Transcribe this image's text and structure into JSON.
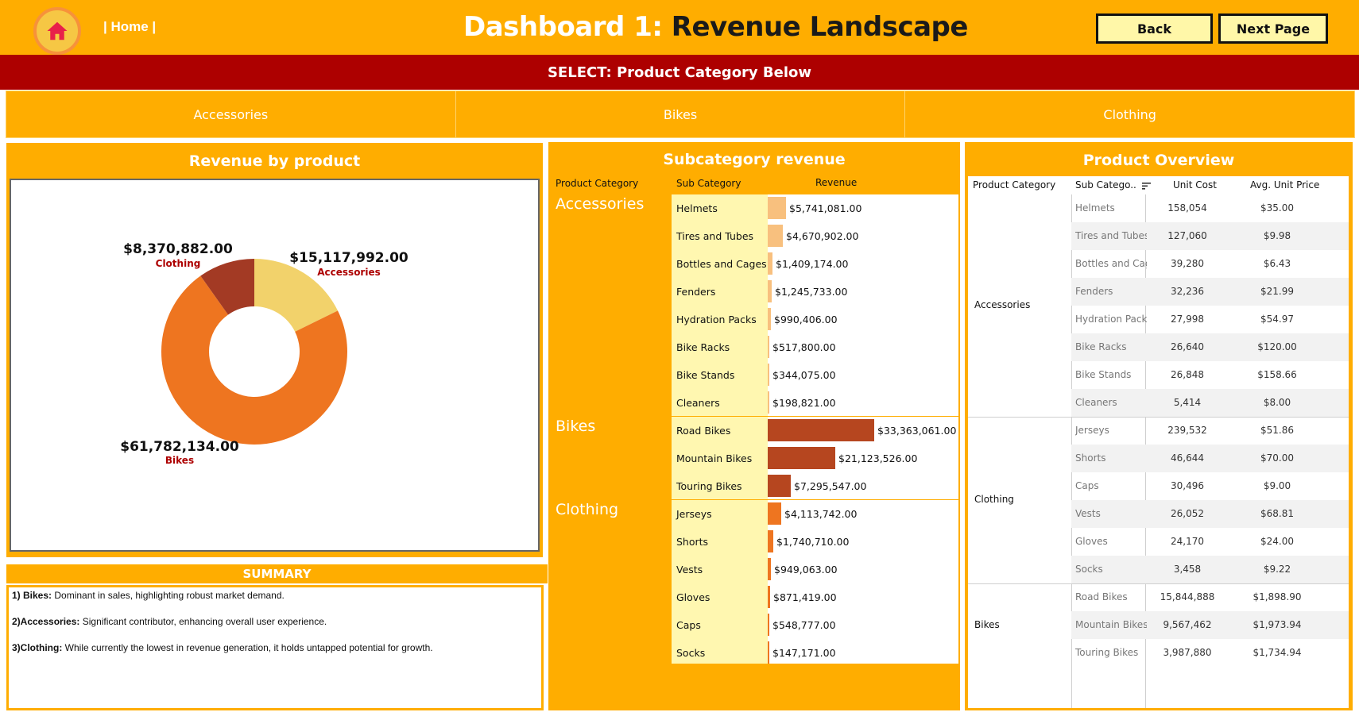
{
  "header": {
    "home_label": "| Home |",
    "title_prefix": "Dashboard 1:",
    "title_main": "Revenue Landscape",
    "back_label": "Back",
    "next_label": "Next Page",
    "accent_color": "#FFAD00",
    "banner_color": "#AD0000"
  },
  "select_banner": "SELECT: Product Category Below",
  "category_filter": [
    "Accessories",
    "Bikes",
    "Clothing"
  ],
  "revenue_by_product": {
    "title": "Revenue by product",
    "slices": [
      {
        "label": "Accessories",
        "value_text": "$15,117,992.00",
        "color": "#F2D26B"
      },
      {
        "label": "Bikes",
        "value_text": "$61,782,134.00",
        "color": "#EE7520"
      },
      {
        "label": "Clothing",
        "value_text": "$8,370,882.00",
        "color": "#A33A24"
      }
    ]
  },
  "summary": {
    "title": "SUMMARY",
    "items": [
      {
        "head": "1) Bikes:",
        "text": " Dominant in sales, highlighting robust market demand."
      },
      {
        "head": "2)Accessories:",
        "text": " Significant contributor, enhancing overall user experience."
      },
      {
        "head": "3)Clothing:",
        "text": " While currently the lowest in revenue generation, it holds untapped potential for growth."
      }
    ]
  },
  "subcategory_revenue": {
    "title": "Subcategory revenue",
    "col_category": "Product Category",
    "col_sub": "Sub Category",
    "col_revenue": "Revenue",
    "groups": [
      {
        "category": "Accessories",
        "rows": [
          {
            "sub": "Helmets",
            "revenue_text": "$5,741,081.00",
            "revenue": 5741081
          },
          {
            "sub": "Tires and Tubes",
            "revenue_text": "$4,670,902.00",
            "revenue": 4670902
          },
          {
            "sub": "Bottles and Cages",
            "revenue_text": "$1,409,174.00",
            "revenue": 1409174
          },
          {
            "sub": "Fenders",
            "revenue_text": "$1,245,733.00",
            "revenue": 1245733
          },
          {
            "sub": "Hydration Packs",
            "revenue_text": "$990,406.00",
            "revenue": 990406
          },
          {
            "sub": "Bike Racks",
            "revenue_text": "$517,800.00",
            "revenue": 517800
          },
          {
            "sub": "Bike Stands",
            "revenue_text": "$344,075.00",
            "revenue": 344075
          },
          {
            "sub": "Cleaners",
            "revenue_text": "$198,821.00",
            "revenue": 198821
          }
        ]
      },
      {
        "category": "Bikes",
        "rows": [
          {
            "sub": "Road Bikes",
            "revenue_text": "$33,363,061.00",
            "revenue": 33363061
          },
          {
            "sub": "Mountain Bikes",
            "revenue_text": "$21,123,526.00",
            "revenue": 21123526
          },
          {
            "sub": "Touring Bikes",
            "revenue_text": "$7,295,547.00",
            "revenue": 7295547
          }
        ]
      },
      {
        "category": "Clothing",
        "rows": [
          {
            "sub": "Jerseys",
            "revenue_text": "$4,113,742.00",
            "revenue": 4113742
          },
          {
            "sub": "Shorts",
            "revenue_text": "$1,740,710.00",
            "revenue": 1740710
          },
          {
            "sub": "Vests",
            "revenue_text": "$949,063.00",
            "revenue": 949063
          },
          {
            "sub": "Gloves",
            "revenue_text": "$871,419.00",
            "revenue": 871419
          },
          {
            "sub": "Caps",
            "revenue_text": "$548,777.00",
            "revenue": 548777
          },
          {
            "sub": "Socks",
            "revenue_text": "$147,171.00",
            "revenue": 147171
          }
        ]
      }
    ]
  },
  "product_overview": {
    "title": "Product Overview",
    "col_category": "Product Category",
    "col_sub": "Sub Catego..",
    "col_cost": "Unit Cost",
    "col_price": "Avg. Unit Price",
    "groups": [
      {
        "category": "Accessories",
        "rows": [
          {
            "sub": "Helmets",
            "cost": "158,054",
            "price": "$35.00"
          },
          {
            "sub": "Tires and Tubes",
            "cost": "127,060",
            "price": "$9.98"
          },
          {
            "sub": "Bottles and Cages",
            "cost": "39,280",
            "price": "$6.43"
          },
          {
            "sub": "Fenders",
            "cost": "32,236",
            "price": "$21.99"
          },
          {
            "sub": "Hydration Packs",
            "cost": "27,998",
            "price": "$54.97"
          },
          {
            "sub": "Bike Racks",
            "cost": "26,640",
            "price": "$120.00"
          },
          {
            "sub": "Bike Stands",
            "cost": "26,848",
            "price": "$158.66"
          },
          {
            "sub": "Cleaners",
            "cost": "5,414",
            "price": "$8.00"
          }
        ]
      },
      {
        "category": "Clothing",
        "rows": [
          {
            "sub": "Jerseys",
            "cost": "239,532",
            "price": "$51.86"
          },
          {
            "sub": "Shorts",
            "cost": "46,644",
            "price": "$70.00"
          },
          {
            "sub": "Caps",
            "cost": "30,496",
            "price": "$9.00"
          },
          {
            "sub": "Vests",
            "cost": "26,052",
            "price": "$68.81"
          },
          {
            "sub": "Gloves",
            "cost": "24,170",
            "price": "$24.00"
          },
          {
            "sub": "Socks",
            "cost": "3,458",
            "price": "$9.22"
          }
        ]
      },
      {
        "category": "Bikes",
        "rows": [
          {
            "sub": "Road Bikes",
            "cost": "15,844,888",
            "price": "$1,898.90"
          },
          {
            "sub": "Mountain Bikes",
            "cost": "9,567,462",
            "price": "$1,973.94"
          },
          {
            "sub": "Touring Bikes",
            "cost": "3,987,880",
            "price": "$1,734.94"
          }
        ]
      }
    ]
  },
  "chart_data": [
    {
      "type": "pie",
      "title": "Revenue by product",
      "categories": [
        "Accessories",
        "Bikes",
        "Clothing"
      ],
      "values": [
        15117992,
        61782134,
        8370882
      ]
    },
    {
      "type": "bar",
      "title": "Subcategory revenue",
      "categories": [
        "Helmets",
        "Tires and Tubes",
        "Bottles and Cages",
        "Fenders",
        "Hydration Packs",
        "Bike Racks",
        "Bike Stands",
        "Cleaners",
        "Road Bikes",
        "Mountain Bikes",
        "Touring Bikes",
        "Jerseys",
        "Shorts",
        "Vests",
        "Gloves",
        "Caps",
        "Socks"
      ],
      "values": [
        5741081,
        4670902,
        1409174,
        1245733,
        990406,
        517800,
        344075,
        198821,
        33363061,
        21123526,
        7295547,
        4113742,
        1740710,
        949063,
        871419,
        548777,
        147171
      ]
    }
  ]
}
